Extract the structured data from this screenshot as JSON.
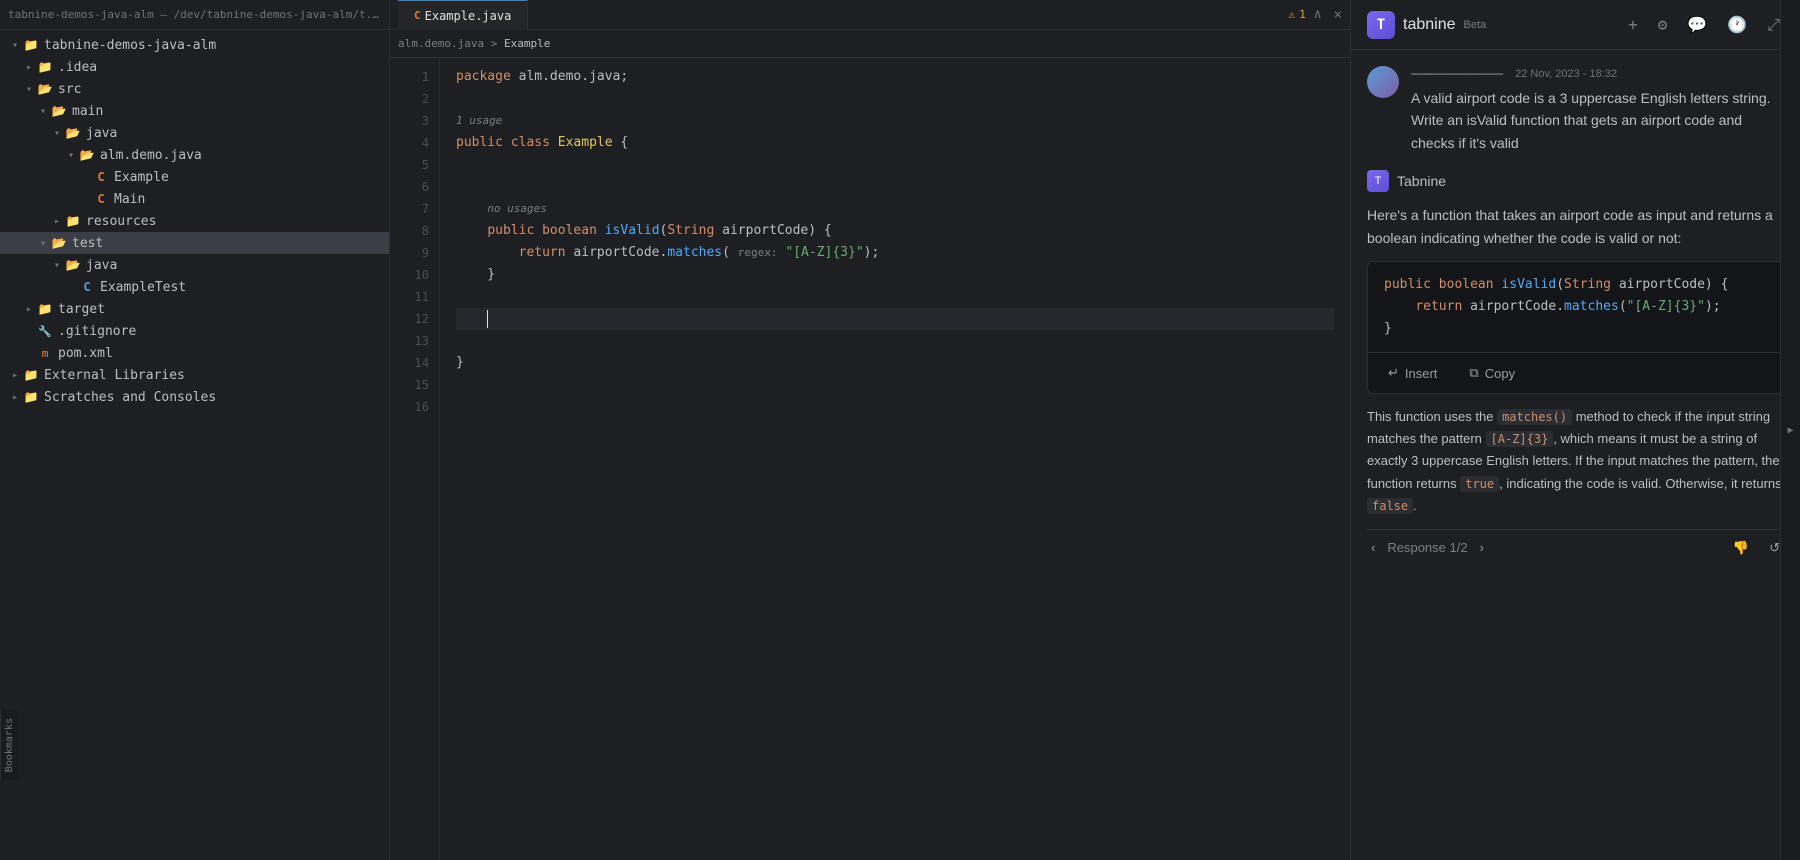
{
  "window": {
    "title": "tabnine-demos-java-alm – /dev/tabnine-demos-java-alm/t..."
  },
  "sidebar": {
    "title": "tabnine-demos-java-alm",
    "items": [
      {
        "id": "root",
        "label": "tabnine-demos-java-alm",
        "type": "folder-open",
        "indent": 0,
        "arrow": "▾",
        "selected": false
      },
      {
        "id": "idea",
        "label": ".idea",
        "type": "folder",
        "indent": 1,
        "arrow": "▸",
        "selected": false
      },
      {
        "id": "src",
        "label": "src",
        "type": "folder-open",
        "indent": 1,
        "arrow": "▾",
        "selected": false
      },
      {
        "id": "main",
        "label": "main",
        "type": "folder-open",
        "indent": 2,
        "arrow": "▾",
        "selected": false
      },
      {
        "id": "java",
        "label": "java",
        "type": "folder-open",
        "indent": 3,
        "arrow": "▾",
        "selected": false
      },
      {
        "id": "alm-demo-java",
        "label": "alm.demo.java",
        "type": "folder-open",
        "indent": 4,
        "arrow": "▾",
        "selected": false
      },
      {
        "id": "Example",
        "label": "Example",
        "type": "class-orange",
        "indent": 5,
        "arrow": "",
        "selected": false
      },
      {
        "id": "Main",
        "label": "Main",
        "type": "class-orange",
        "indent": 5,
        "arrow": "",
        "selected": false
      },
      {
        "id": "resources",
        "label": "resources",
        "type": "folder",
        "indent": 3,
        "arrow": "▸",
        "selected": false
      },
      {
        "id": "test",
        "label": "test",
        "type": "folder-open",
        "indent": 2,
        "arrow": "▾",
        "selected": true
      },
      {
        "id": "test-java",
        "label": "java",
        "type": "folder-open",
        "indent": 3,
        "arrow": "▾",
        "selected": false
      },
      {
        "id": "ExampleTest",
        "label": "ExampleTest",
        "type": "class-blue",
        "indent": 4,
        "arrow": "",
        "selected": false
      },
      {
        "id": "target",
        "label": "target",
        "type": "folder",
        "indent": 1,
        "arrow": "▸",
        "selected": false
      },
      {
        "id": "gitignore",
        "label": ".gitignore",
        "type": "git",
        "indent": 1,
        "arrow": "",
        "selected": false
      },
      {
        "id": "pom",
        "label": "pom.xml",
        "type": "xml",
        "indent": 1,
        "arrow": "",
        "selected": false
      },
      {
        "id": "ext-libs",
        "label": "External Libraries",
        "type": "folder",
        "indent": 0,
        "arrow": "▸",
        "selected": false
      },
      {
        "id": "scratches",
        "label": "Scratches and Consoles",
        "type": "folder",
        "indent": 0,
        "arrow": "▸",
        "selected": false
      }
    ]
  },
  "editor": {
    "tab_label": "Example.java",
    "file_path": "alm.demo.java",
    "warning_count": "1",
    "lines": [
      {
        "num": "1",
        "content": "package alm.demo.java;",
        "type": "package"
      },
      {
        "num": "2",
        "content": "",
        "type": "blank"
      },
      {
        "num": "3",
        "content": "1 usage",
        "type": "usage"
      },
      {
        "num": "4",
        "content": "public class Example {",
        "type": "code"
      },
      {
        "num": "5",
        "content": "",
        "type": "blank"
      },
      {
        "num": "6",
        "content": "",
        "type": "blank"
      },
      {
        "num": "7",
        "content": "    no usages",
        "type": "usage"
      },
      {
        "num": "8",
        "content": "    public boolean isValid(String airportCode) {",
        "type": "code"
      },
      {
        "num": "9",
        "content": "        return airportCode.matches( regex: \"[A-Z]{3}\");",
        "type": "code"
      },
      {
        "num": "10",
        "content": "    }",
        "type": "code"
      },
      {
        "num": "11",
        "content": "",
        "type": "blank"
      },
      {
        "num": "12",
        "content": "",
        "type": "blank-cursor"
      },
      {
        "num": "13",
        "content": "",
        "type": "blank"
      },
      {
        "num": "14",
        "content": "}",
        "type": "code"
      },
      {
        "num": "15",
        "content": "",
        "type": "blank"
      },
      {
        "num": "16",
        "content": "",
        "type": "blank"
      }
    ]
  },
  "tabnine": {
    "title": "tabnine",
    "beta_label": "Beta",
    "logo_char": "T",
    "actions": {
      "add": "+",
      "settings": "⚙",
      "chat": "💬",
      "history": "🕐",
      "expand": "⤢"
    },
    "user_message": {
      "avatar_color": "#5c9bd6",
      "sender": "──────────",
      "timestamp": "22 Nov, 2023 - 18:32",
      "text": "A valid airport code is a 3 uppercase English letters string. Write an isValid function that gets an airport code and checks if it's valid"
    },
    "response": {
      "sender": "Tabnine",
      "intro_text": "Here's a function that takes an airport code as input and returns a boolean indicating whether the code is valid or not:",
      "code": {
        "lines": [
          "public boolean isValid(String airportCode) {",
          "    return airportCode.matches(\"[A-Z]{3}\");",
          "}"
        ]
      },
      "insert_label": "Insert",
      "copy_label": "Copy",
      "explanation": {
        "parts": [
          {
            "type": "text",
            "content": "This function uses the "
          },
          {
            "type": "code",
            "content": "matches()"
          },
          {
            "type": "text",
            "content": " method to check if the input string matches the pattern "
          },
          {
            "type": "code",
            "content": "[A-Z]{3}"
          },
          {
            "type": "text",
            "content": ", which means it must be a string of exactly 3 uppercase English letters. If the input matches the pattern, the function returns "
          },
          {
            "type": "code",
            "content": "true"
          },
          {
            "type": "text",
            "content": ", indicating the code is valid. Otherwise, it returns "
          },
          {
            "type": "code",
            "content": "false"
          },
          {
            "type": "text",
            "content": "."
          }
        ]
      },
      "nav_label": "Response 1/2"
    }
  }
}
